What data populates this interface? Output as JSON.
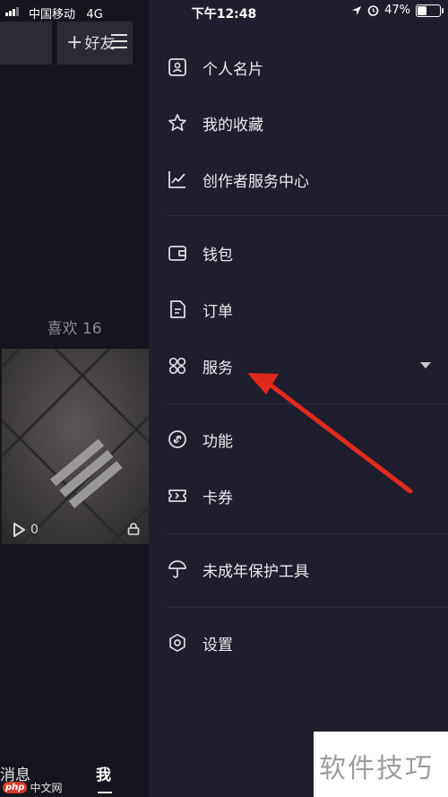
{
  "status_bar": {
    "carrier": "中国移动",
    "network": "4G",
    "time": "下午12:48",
    "battery_percent": "47%",
    "battery_level": 0.47
  },
  "background": {
    "friend_label": "好友",
    "friend_plus": "+",
    "likes_label": "喜欢 16",
    "play_count": "0",
    "tab_messages": "消息",
    "tab_me": "我"
  },
  "drawer": {
    "items": [
      {
        "label": "个人名片",
        "icon": "id-card-icon"
      },
      {
        "label": "我的收藏",
        "icon": "star-icon"
      },
      {
        "label": "创作者服务中心",
        "icon": "chart-icon"
      },
      {
        "label": "钱包",
        "icon": "wallet-icon"
      },
      {
        "label": "订单",
        "icon": "document-icon"
      },
      {
        "label": "服务",
        "icon": "grid-icon"
      },
      {
        "label": "功能",
        "icon": "link-icon"
      },
      {
        "label": "卡券",
        "icon": "ticket-icon"
      },
      {
        "label": "未成年保护工具",
        "icon": "umbrella-icon"
      },
      {
        "label": "设置",
        "icon": "gear-icon"
      }
    ]
  },
  "watermark": {
    "text": "软件技巧",
    "site_logo": "php",
    "site_text": "中文网"
  },
  "colors": {
    "drawer_bg": "#1e1e2c",
    "arrow": "#e02a1f"
  }
}
